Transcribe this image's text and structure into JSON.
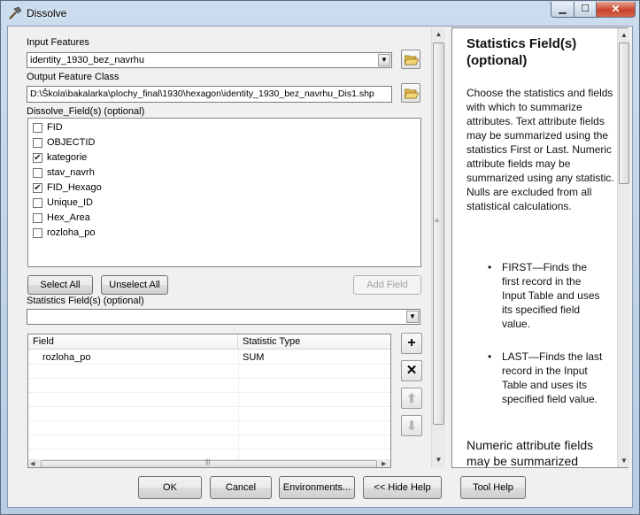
{
  "window": {
    "title": "Dissolve",
    "title_icon": "hammer-icon",
    "min_glyph": "▁",
    "max_glyph": "☐",
    "close_glyph": "✕"
  },
  "form": {
    "input_features_label": "Input Features",
    "input_features_value": "identity_1930_bez_navrhu",
    "output_class_label": "Output Feature Class",
    "output_class_value": "D:\\Škola\\bakalarka\\plochy_final\\1930\\hexagon\\identity_1930_bez_navrhu_Dis1.shp",
    "dissolve_label": "Dissolve_Field(s) (optional)",
    "fields": [
      {
        "name": "FID",
        "checked": false
      },
      {
        "name": "OBJECTID",
        "checked": false
      },
      {
        "name": "kategorie",
        "checked": true
      },
      {
        "name": "stav_navrh",
        "checked": false
      },
      {
        "name": "FID_Hexago",
        "checked": true
      },
      {
        "name": "Unique_ID",
        "checked": false
      },
      {
        "name": "Hex_Area",
        "checked": false
      },
      {
        "name": "rozloha_po",
        "checked": false
      }
    ],
    "select_all": "Select All",
    "unselect_all": "Unselect All",
    "add_field": "Add Field",
    "stats_label": "Statistics Field(s) (optional)",
    "stats_value": "",
    "table": {
      "headers": [
        "Field",
        "Statistic Type"
      ],
      "rows": [
        {
          "field": "rozloha_po",
          "stat": "SUM"
        }
      ]
    },
    "side_buttons": {
      "add": "+",
      "remove": "✕",
      "up": "⬆",
      "down": "⬇"
    }
  },
  "help": {
    "title": "Statistics Field(s) (optional)",
    "paragraph": "Choose the statistics and fields with which to summarize attributes. Text attribute fields may be summarized using the statistics First or Last. Numeric attribute fields may be summarized using any statistic. Nulls are excluded from all statistical calculations.",
    "bullets": [
      "FIRST—Finds the first record in the Input Table and uses its specified field value.",
      "LAST—Finds the last record in the Input Table and uses its specified field value."
    ],
    "tail": "Numeric attribute fields may be summarized"
  },
  "buttons": {
    "ok": "OK",
    "cancel": "Cancel",
    "environments": "Environments...",
    "hide_help": "<< Hide Help",
    "tool_help": "Tool Help"
  }
}
